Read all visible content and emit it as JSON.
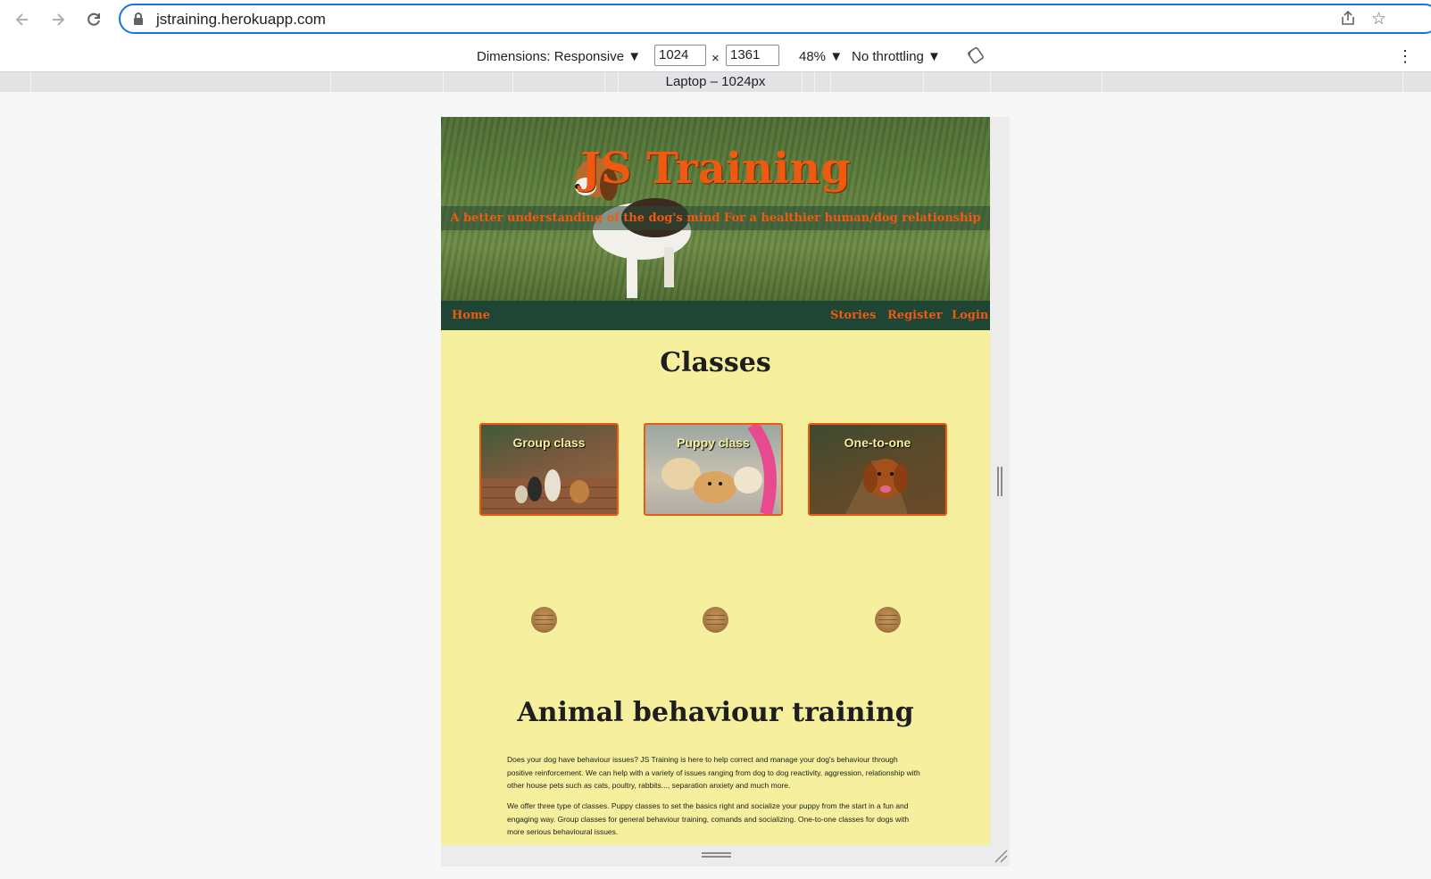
{
  "browser": {
    "url": "jstraining.herokuapp.com",
    "back_icon": "back-arrow-icon",
    "forward_icon": "forward-arrow-icon",
    "reload_icon": "reload-icon"
  },
  "devtools": {
    "dimensions_label": "Dimensions: Responsive ▼",
    "width": "1024",
    "times": "×",
    "height": "1361",
    "zoom": "48% ▼",
    "throttling": "No throttling ▼",
    "media_query_label": "Laptop – 1024px"
  },
  "site": {
    "title": "JS Training",
    "tagline": "A better understanding of the dog's mind For a healthier human/dog relationship",
    "nav": {
      "home": "Home",
      "stories": "Stories",
      "register": "Register",
      "login": "Login"
    },
    "classes_heading": "Classes",
    "cards": [
      {
        "caption": "Group class"
      },
      {
        "caption": "Puppy class"
      },
      {
        "caption": "One-to-one"
      }
    ],
    "behaviour_heading": "Animal behaviour training",
    "paragraphs": [
      "Does your dog have behaviour issues? JS Training is here to help correct and manage your dog's behaviour through positive reinforcement. We can help with a variety of issues ranging from dog to dog reactivity, aggression, relationship with other house pets such as cats, poultry, rabbits..., separation anxiety and much more.",
      "We offer three type of classes. Puppy classes to set the basics right and socialize your puppy from the start in a fun and engaging way. Group classes for general behaviour training, comands and socializing. One-to-one classes for dogs with more serious behavioural issues."
    ]
  },
  "colors": {
    "accent": "#ee5a12",
    "nav_bg": "#1f4535",
    "page_bg": "#f5ef9e"
  }
}
